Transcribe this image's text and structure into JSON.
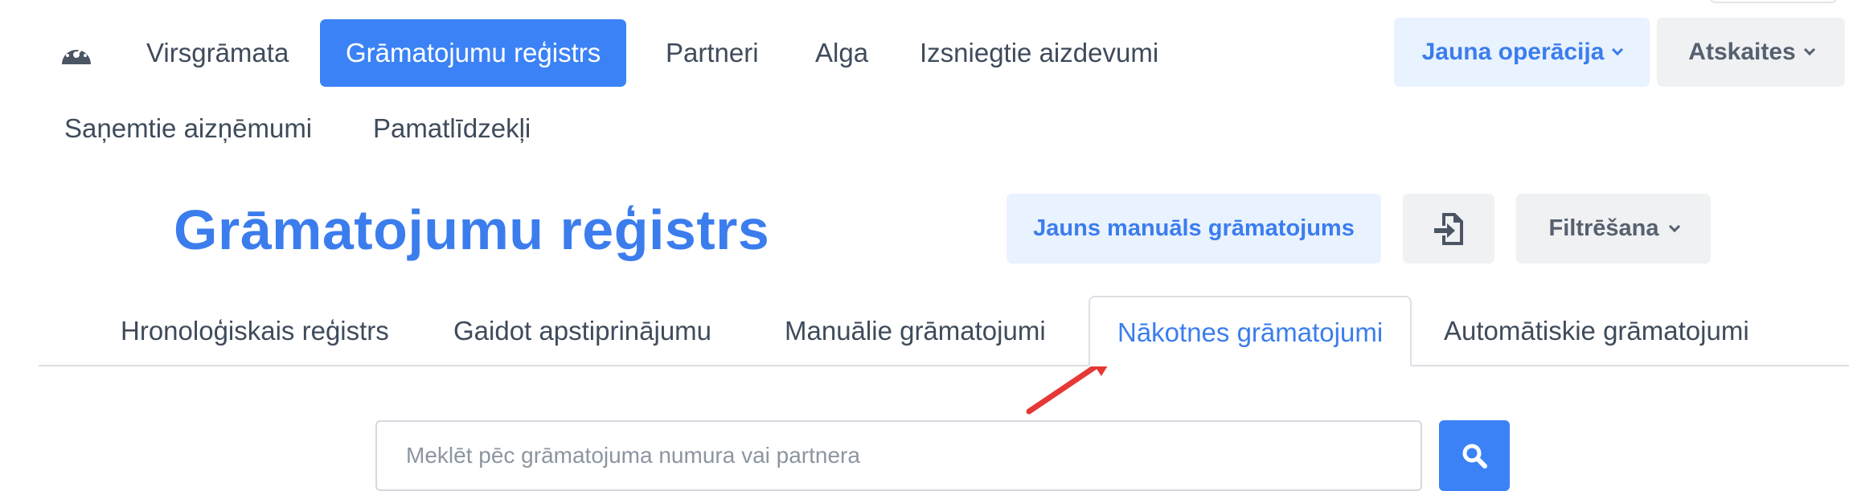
{
  "topnav": {
    "items": [
      {
        "label": "Virsgrāmata"
      },
      {
        "label": "Grāmatojumu reģistrs",
        "active": true
      },
      {
        "label": "Partneri"
      },
      {
        "label": "Alga"
      },
      {
        "label": "Izsniegtie aizdevumi"
      },
      {
        "label": "Saņemtie aizņēmumi"
      },
      {
        "label": "Pamatlīdzekļi"
      }
    ],
    "new_operation_label": "Jauna operācija",
    "reports_label": "Atskaites"
  },
  "page": {
    "title": "Grāmatojumu reģistrs",
    "manual_entry_label": "Jauns manuāls grāmatojums",
    "filter_label": "Filtrēšana"
  },
  "tabs": [
    {
      "label": "Hronoloģiskais reģistrs"
    },
    {
      "label": "Gaidot apstiprinājumu"
    },
    {
      "label": "Manuālie grāmatojumi"
    },
    {
      "label": "Nākotnes grāmatojumi",
      "active": true
    },
    {
      "label": "Automātiskie grāmatojumi"
    }
  ],
  "search": {
    "placeholder": "Meklēt pēc grāmatojuma numura vai partnera",
    "value": ""
  },
  "icons": {
    "dashboard": "dashboard-gauge-icon",
    "import": "file-import-icon",
    "search": "search-icon",
    "chevron": "chevron-down-icon",
    "annotation_arrow": "red-arrow-annotation"
  },
  "colors": {
    "accent": "#3b82f6",
    "accent_text": "#3b7ded",
    "light_accent_bg": "#e9f2ff",
    "neutral_button_bg": "#f0f1f3",
    "annotation": "#e53935"
  }
}
